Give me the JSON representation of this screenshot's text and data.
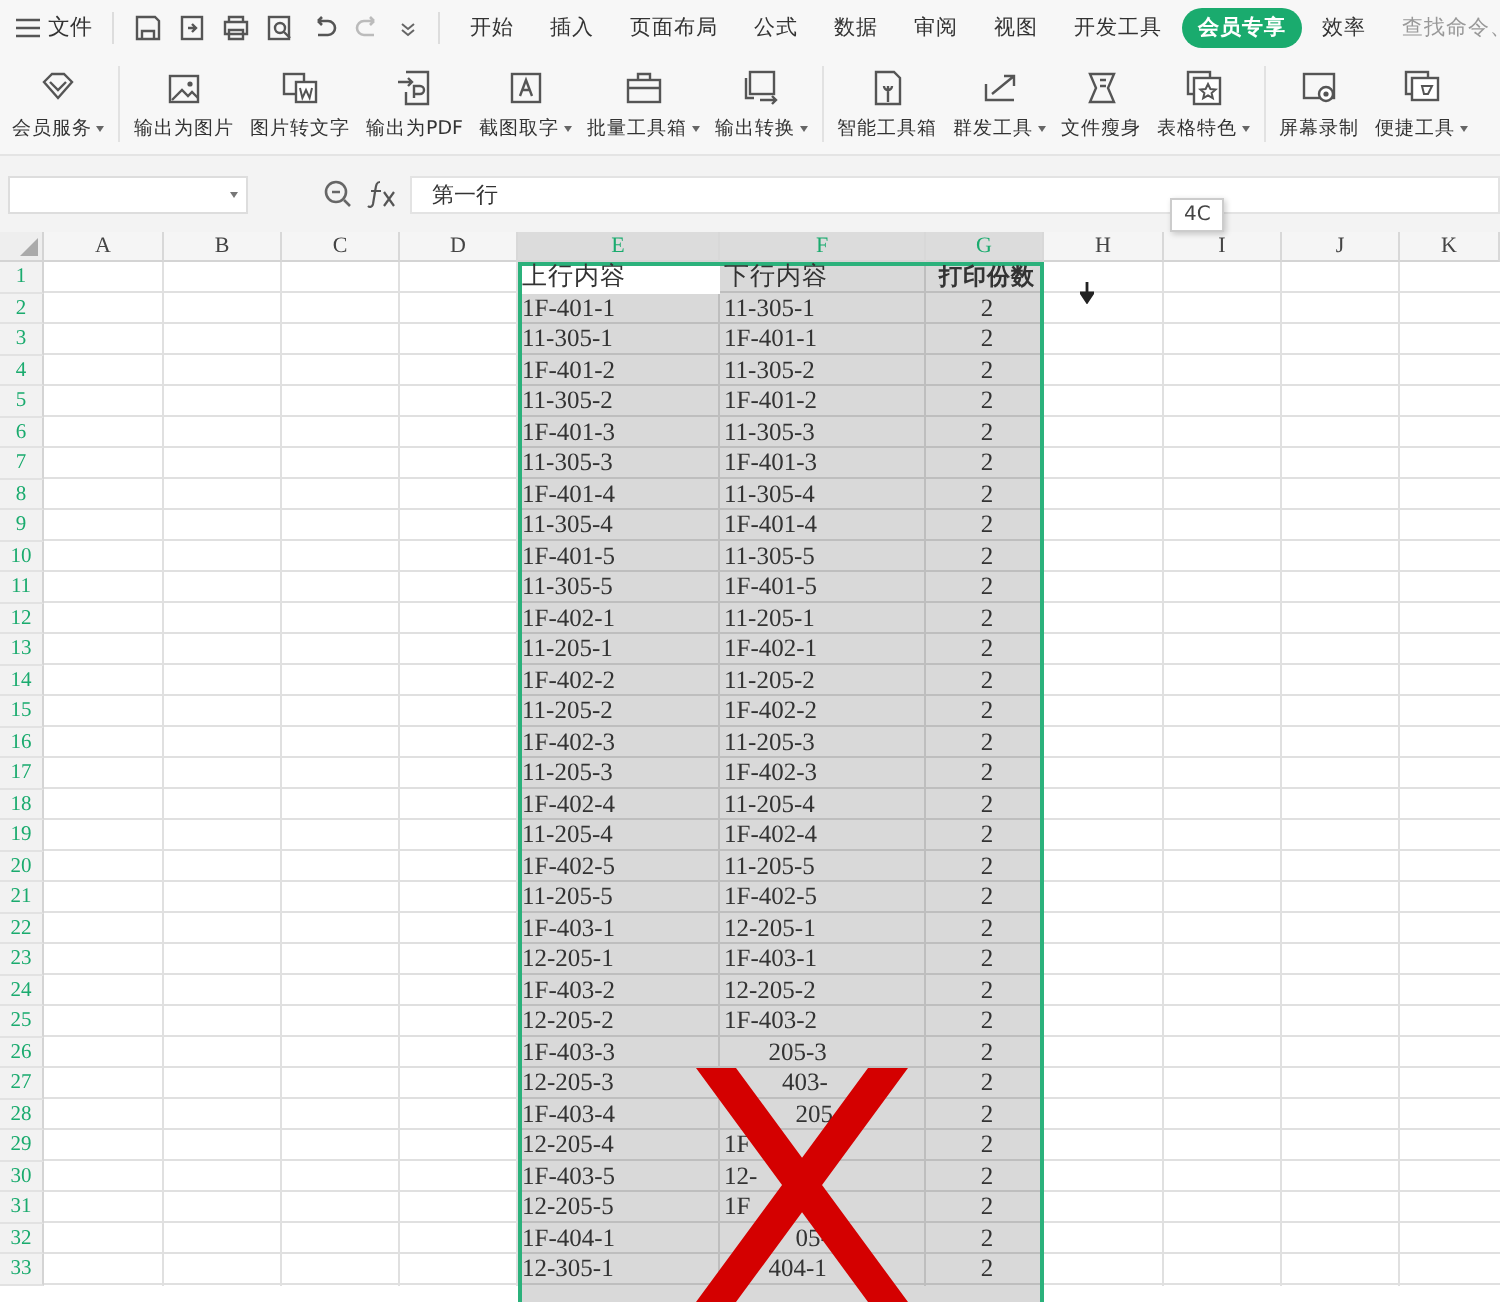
{
  "menu_bar": {
    "file_label": "文件",
    "tabs": [
      {
        "label": "开始",
        "selected": false
      },
      {
        "label": "插入",
        "selected": false
      },
      {
        "label": "页面布局",
        "selected": false
      },
      {
        "label": "公式",
        "selected": false
      },
      {
        "label": "数据",
        "selected": false
      },
      {
        "label": "审阅",
        "selected": false
      },
      {
        "label": "视图",
        "selected": false
      },
      {
        "label": "开发工具",
        "selected": false
      },
      {
        "label": "会员专享",
        "selected": true
      },
      {
        "label": "效率",
        "selected": false
      }
    ],
    "search": {
      "placeholder": "查找命令、"
    }
  },
  "ribbon_groups": [
    [
      {
        "label": "会员服务",
        "dropdown": true
      }
    ],
    [
      {
        "label": "输出为图片",
        "dropdown": false
      },
      {
        "label": "图片转文字",
        "dropdown": false
      },
      {
        "label": "输出为PDF",
        "dropdown": false
      },
      {
        "label": "截图取字",
        "dropdown": true
      },
      {
        "label": "批量工具箱",
        "dropdown": true
      },
      {
        "label": "输出转换",
        "dropdown": true
      }
    ],
    [
      {
        "label": "智能工具箱",
        "dropdown": false
      },
      {
        "label": "群发工具",
        "dropdown": true
      },
      {
        "label": "文件瘦身",
        "dropdown": false
      },
      {
        "label": "表格特色",
        "dropdown": true
      }
    ],
    [
      {
        "label": "屏幕录制",
        "dropdown": false
      },
      {
        "label": "便捷工具",
        "dropdown": true
      }
    ]
  ],
  "formula_bar": {
    "value": "第一行"
  },
  "tooltip": "4C",
  "sheet": {
    "columns": [
      {
        "label": "A",
        "selected": false
      },
      {
        "label": "B",
        "selected": false
      },
      {
        "label": "C",
        "selected": false
      },
      {
        "label": "D",
        "selected": false
      },
      {
        "label": "E",
        "selected": true
      },
      {
        "label": "F",
        "selected": true
      },
      {
        "label": "G",
        "selected": true
      },
      {
        "label": "H",
        "selected": false
      },
      {
        "label": "I",
        "selected": false
      },
      {
        "label": "J",
        "selected": false
      },
      {
        "label": "K",
        "selected": false
      }
    ],
    "rows": [
      {
        "number": "1",
        "selected": true,
        "cells": [
          "上行内容",
          "下行内容",
          "打印份数"
        ]
      },
      {
        "number": "2",
        "selected": true,
        "cells": [
          "1F-401-1",
          "11-305-1",
          "2"
        ]
      },
      {
        "number": "3",
        "selected": true,
        "cells": [
          "11-305-1",
          "1F-401-1",
          "2"
        ]
      },
      {
        "number": "4",
        "selected": true,
        "cells": [
          "1F-401-2",
          "11-305-2",
          "2"
        ]
      },
      {
        "number": "5",
        "selected": true,
        "cells": [
          "11-305-2",
          "1F-401-2",
          "2"
        ]
      },
      {
        "number": "6",
        "selected": true,
        "cells": [
          "1F-401-3",
          "11-305-3",
          "2"
        ]
      },
      {
        "number": "7",
        "selected": true,
        "cells": [
          "11-305-3",
          "1F-401-3",
          "2"
        ]
      },
      {
        "number": "8",
        "selected": true,
        "cells": [
          "1F-401-4",
          "11-305-4",
          "2"
        ]
      },
      {
        "number": "9",
        "selected": true,
        "cells": [
          "11-305-4",
          "1F-401-4",
          "2"
        ]
      },
      {
        "number": "10",
        "selected": true,
        "cells": [
          "1F-401-5",
          "11-305-5",
          "2"
        ]
      },
      {
        "number": "11",
        "selected": true,
        "cells": [
          "11-305-5",
          "1F-401-5",
          "2"
        ]
      },
      {
        "number": "12",
        "selected": true,
        "cells": [
          "1F-402-1",
          "11-205-1",
          "2"
        ]
      },
      {
        "number": "13",
        "selected": true,
        "cells": [
          "11-205-1",
          "1F-402-1",
          "2"
        ]
      },
      {
        "number": "14",
        "selected": true,
        "cells": [
          "1F-402-2",
          "11-205-2",
          "2"
        ]
      },
      {
        "number": "15",
        "selected": true,
        "cells": [
          "11-205-2",
          "1F-402-2",
          "2"
        ]
      },
      {
        "number": "16",
        "selected": true,
        "cells": [
          "1F-402-3",
          "11-205-3",
          "2"
        ]
      },
      {
        "number": "17",
        "selected": true,
        "cells": [
          "11-205-3",
          "1F-402-3",
          "2"
        ]
      },
      {
        "number": "18",
        "selected": true,
        "cells": [
          "1F-402-4",
          "11-205-4",
          "2"
        ]
      },
      {
        "number": "19",
        "selected": true,
        "cells": [
          "11-205-4",
          "1F-402-4",
          "2"
        ]
      },
      {
        "number": "20",
        "selected": true,
        "cells": [
          "1F-402-5",
          "11-205-5",
          "2"
        ]
      },
      {
        "number": "21",
        "selected": true,
        "cells": [
          "11-205-5",
          "1F-402-5",
          "2"
        ]
      },
      {
        "number": "22",
        "selected": true,
        "cells": [
          "1F-403-1",
          "12-205-1",
          "2"
        ]
      },
      {
        "number": "23",
        "selected": true,
        "cells": [
          "12-205-1",
          "1F-403-1",
          "2"
        ]
      },
      {
        "number": "24",
        "selected": true,
        "cells": [
          "1F-403-2",
          "12-205-2",
          "2"
        ]
      },
      {
        "number": "25",
        "selected": true,
        "cells": [
          "12-205-2",
          "1F-403-2",
          "2"
        ]
      },
      {
        "number": "26",
        "selected": true,
        "cells": [
          "1F-403-3",
          "205-3",
          "2"
        ],
        "hidden_start": true
      },
      {
        "number": "27",
        "selected": true,
        "cells": [
          "12-205-3",
          "403-",
          "2"
        ],
        "hidden_start": true
      },
      {
        "number": "28",
        "selected": true,
        "cells": [
          "1F-403-4",
          "205",
          "2"
        ],
        "hidden_start": true
      },
      {
        "number": "29",
        "selected": true,
        "cells": [
          "12-205-4",
          "1F",
          "2"
        ]
      },
      {
        "number": "30",
        "selected": true,
        "cells": [
          "1F-403-5",
          "12-",
          "2"
        ]
      },
      {
        "number": "31",
        "selected": true,
        "cells": [
          "12-205-5",
          "1F",
          "2"
        ]
      },
      {
        "number": "32",
        "selected": true,
        "cells": [
          "1F-404-1",
          "05-",
          "2"
        ],
        "hidden_start": true
      },
      {
        "number": "33",
        "selected": true,
        "cells": [
          "12-305-1",
          "404-1",
          "2"
        ],
        "hidden_start": true
      }
    ]
  }
}
